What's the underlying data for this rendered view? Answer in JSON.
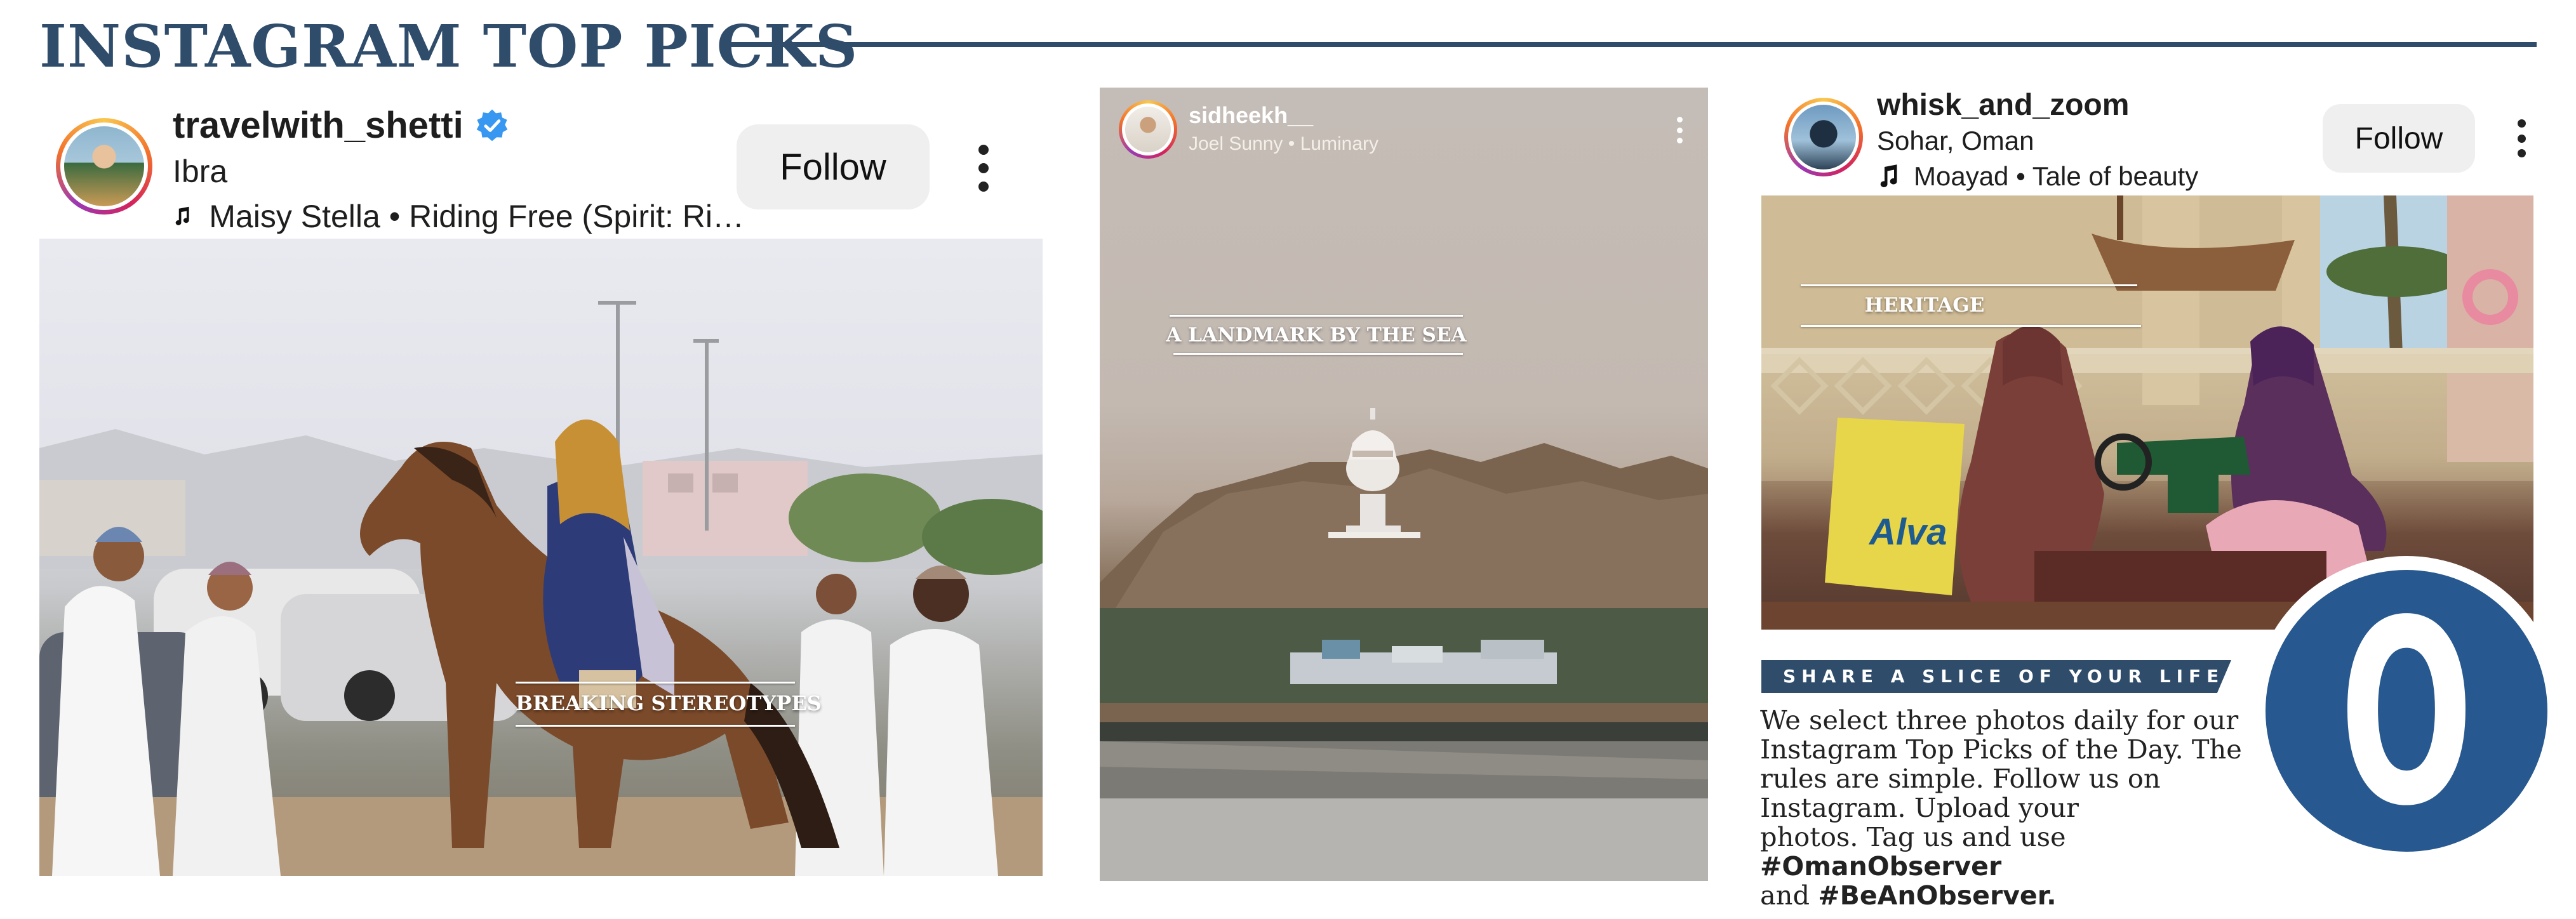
{
  "page": {
    "title": "INSTAGRAM TOP PICKS"
  },
  "colors": {
    "brand_navy": "#2f4c6b",
    "logo_blue": "#27588f",
    "verified_blue": "#3897f0"
  },
  "posts": [
    {
      "username": "travelwith_shetti",
      "verified": true,
      "location": "Ibra",
      "music": "Maisy Stella • Riding Free (Spirit: Ri…",
      "follow_label": "Follow",
      "caption": "BREAKING STEREOTYPES",
      "icons": [
        "verified-badge-icon",
        "music-note-icon",
        "more-options-icon"
      ]
    },
    {
      "username": "sidheekh__",
      "subtitle": "Joel Sunny • Luminary",
      "caption": "A LANDMARK BY THE SEA",
      "icons": [
        "more-options-icon"
      ]
    },
    {
      "username": "whisk_and_zoom",
      "location": "Sohar, Oman",
      "music": "Moayad • Tale of beauty",
      "follow_label": "Follow",
      "caption": "HERITAGE",
      "photo_bag_text": "Alva",
      "icons": [
        "music-note-icon",
        "more-options-icon"
      ]
    }
  ],
  "info_box": {
    "banner": "SHARE A SLICE OF YOUR LIFE",
    "lines": [
      "We select three photos daily for our",
      "Instagram Top Picks of the Day. The",
      "rules are simple. Follow us on",
      "Instagram. Upload your",
      "photos. Tag us and use "
    ],
    "hashtag1": "#OmanObserver",
    "and_text": "and ",
    "hashtag2": "#BeAnObserver.",
    "logo_letter": "O"
  }
}
